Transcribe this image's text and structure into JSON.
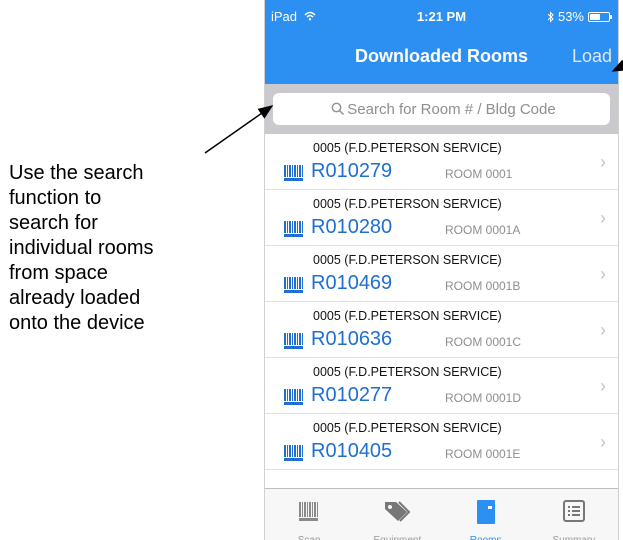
{
  "annotation": {
    "lines": [
      "Use the search",
      "function to",
      "search for",
      "individual rooms",
      "from space",
      "already loaded",
      "onto the device"
    ]
  },
  "status_bar": {
    "device": "iPad",
    "time": "1:21 PM",
    "battery": "53%",
    "battery_level": 0.53
  },
  "nav": {
    "title": "Downloaded Rooms",
    "action": "Load"
  },
  "search": {
    "placeholder": "Search for Room # / Bldg Code",
    "value": ""
  },
  "rooms": [
    {
      "building": "0005 (F.D.PETERSON SERVICE)",
      "id": "R010279",
      "name": "ROOM 0001"
    },
    {
      "building": "0005 (F.D.PETERSON SERVICE)",
      "id": "R010280",
      "name": "ROOM 0001A"
    },
    {
      "building": "0005 (F.D.PETERSON SERVICE)",
      "id": "R010469",
      "name": "ROOM 0001B"
    },
    {
      "building": "0005 (F.D.PETERSON SERVICE)",
      "id": "R010636",
      "name": "ROOM 0001C"
    },
    {
      "building": "0005 (F.D.PETERSON SERVICE)",
      "id": "R010277",
      "name": "ROOM 0001D"
    },
    {
      "building": "0005 (F.D.PETERSON SERVICE)",
      "id": "R010405",
      "name": "ROOM 0001E"
    }
  ],
  "tabs": [
    {
      "label": "Scan",
      "icon": "barcode-icon",
      "active": false
    },
    {
      "label": "Equipment",
      "icon": "tags-icon",
      "active": false
    },
    {
      "label": "Rooms",
      "icon": "door-icon",
      "active": true
    },
    {
      "label": "Summary",
      "icon": "list-icon",
      "active": false
    }
  ],
  "colors": {
    "accent": "#2c8ff2",
    "room_id": "#1f6fd1"
  }
}
